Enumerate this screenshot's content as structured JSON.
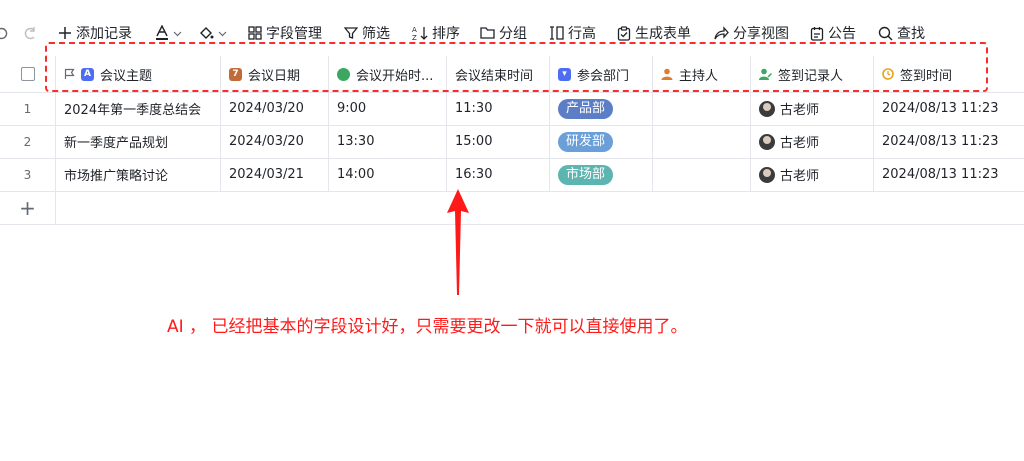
{
  "toolbar": {
    "add_record": "添加记录",
    "fields": "字段管理",
    "filter": "筛选",
    "sort": "排序",
    "group": "分组",
    "row_height": "行高",
    "generate_form": "生成表单",
    "share_view": "分享视图",
    "notice": "公告",
    "find": "查找"
  },
  "columns": [
    "会议主题",
    "会议日期",
    "会议开始时...",
    "会议结束时间",
    "参会部门",
    "主持人",
    "签到记录人",
    "签到时间"
  ],
  "rows": [
    {
      "num": "1",
      "topic": "2024年第一季度总结会",
      "date": "2024/03/20",
      "start": "9:00",
      "end": "11:30",
      "dept": "产品部",
      "host": "",
      "recorder": "古老师",
      "checkin": "2024/08/13 11:23"
    },
    {
      "num": "2",
      "topic": "新一季度产品规划",
      "date": "2024/03/20",
      "start": "13:30",
      "end": "15:00",
      "dept": "研发部",
      "host": "",
      "recorder": "古老师",
      "checkin": "2024/08/13 11:23"
    },
    {
      "num": "3",
      "topic": "市场推广策略讨论",
      "date": "2024/03/21",
      "start": "14:00",
      "end": "16:30",
      "dept": "市场部",
      "host": "",
      "recorder": "古老师",
      "checkin": "2024/08/13 11:23"
    }
  ],
  "dept_colors": {
    "产品部": "#5b7ec7",
    "研发部": "#6a9fd8",
    "市场部": "#5cb5b0"
  },
  "add_row": "+",
  "annotation": "AI ， 已经把基本的字段设计好，只需要更改一下就可以直接使用了。"
}
